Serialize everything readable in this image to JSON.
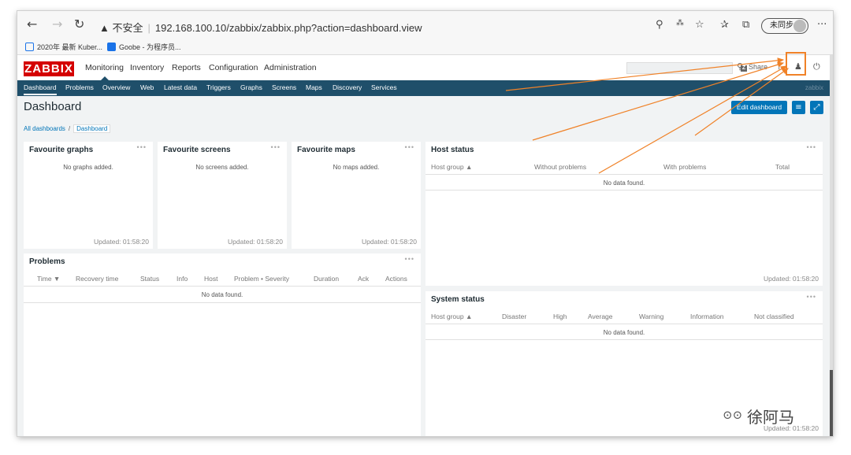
{
  "browser": {
    "back": "←",
    "forward": "→",
    "reload": "↻",
    "security_warning": "▲ 不安全",
    "url": "192.168.100.10/zabbix/zabbix.php?action=dashboard.view",
    "profile_label": "未同步",
    "menu": "···",
    "bookmarks": [
      {
        "label": "2020年 最新 Kuber...",
        "color": "#1a73e8"
      },
      {
        "label": "Goobe - 为程序员...",
        "color": "#1a73e8"
      }
    ]
  },
  "zabbix": {
    "logo": "ZABBIX",
    "top_nav": [
      "Monitoring",
      "Inventory",
      "Reports",
      "Configuration",
      "Administration"
    ],
    "active_top": "Monitoring",
    "share": "Share",
    "help": "?",
    "sub_nav": [
      "Dashboard",
      "Problems",
      "Overview",
      "Web",
      "Latest data",
      "Triggers",
      "Graphs",
      "Screens",
      "Maps",
      "Discovery",
      "Services"
    ],
    "active_sub": "Dashboard",
    "server_name": "zabbix"
  },
  "page": {
    "title": "Dashboard",
    "edit_button": "Edit dashboard",
    "breadcrumb_root": "All dashboards",
    "breadcrumb_sep": "/",
    "breadcrumb_current": "Dashboard"
  },
  "widgets": {
    "fav_graphs": {
      "title": "Favourite graphs",
      "empty": "No graphs added.",
      "updated": "Updated: 01:58:20"
    },
    "fav_screens": {
      "title": "Favourite screens",
      "empty": "No screens added.",
      "updated": "Updated: 01:58:20"
    },
    "fav_maps": {
      "title": "Favourite maps",
      "empty": "No maps added.",
      "updated": "Updated: 01:58:20"
    },
    "host_status": {
      "title": "Host status",
      "columns": [
        "Host group ▲",
        "Without problems",
        "With problems",
        "Total"
      ],
      "empty": "No data found.",
      "updated": "Updated: 01:58:20"
    },
    "problems": {
      "title": "Problems",
      "columns": [
        "Time ▼",
        "Recovery time",
        "Status",
        "Info",
        "Host",
        "Problem • Severity",
        "Duration",
        "Ack",
        "Actions"
      ],
      "empty": "No data found."
    },
    "system_status": {
      "title": "System status",
      "columns": [
        "Host group ▲",
        "Disaster",
        "High",
        "Average",
        "Warning",
        "Information",
        "Not classified"
      ],
      "empty": "No data found.",
      "updated": "Updated: 01:58:20"
    }
  },
  "watermark": "徐阿马",
  "colors": {
    "logo_red": "#d40000",
    "nav_bar": "#1f4f6a",
    "button_blue": "#0275b8",
    "annotation_orange": "#f08228"
  }
}
